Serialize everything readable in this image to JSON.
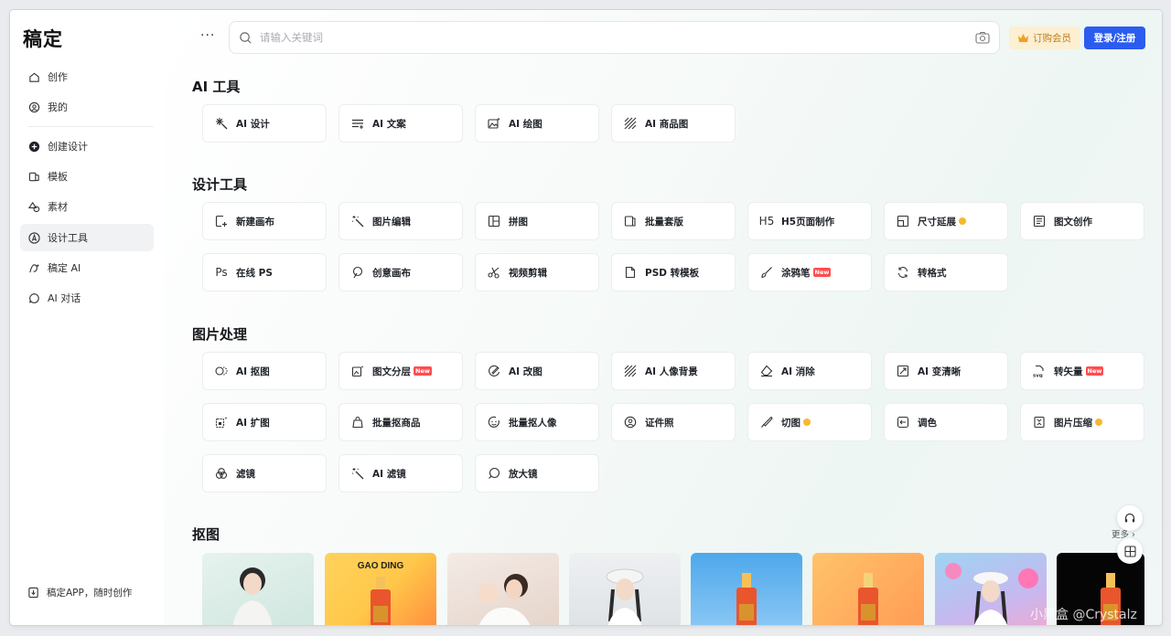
{
  "app": {
    "logo": "稿定"
  },
  "sidebar": {
    "items": [
      {
        "label": "创作",
        "icon": "home-icon"
      },
      {
        "label": "我的",
        "icon": "user-icon"
      },
      {
        "label": "创建设计",
        "icon": "plus-circle-icon"
      },
      {
        "label": "模板",
        "icon": "template-icon"
      },
      {
        "label": "素材",
        "icon": "shapes-icon"
      },
      {
        "label": "设计工具",
        "icon": "compass-icon",
        "active": true
      },
      {
        "label": "稿定 AI",
        "icon": "ai-icon"
      },
      {
        "label": "AI 对话",
        "icon": "chat-icon"
      }
    ],
    "app_link": "稿定APP，随时创作"
  },
  "header": {
    "more": "···",
    "search_placeholder": "请输入关键词",
    "vip_label": "订购会员",
    "login_label": "登录/注册"
  },
  "sections": {
    "ai_tools": {
      "title": "AI 工具",
      "items": [
        {
          "label": "AI 设计",
          "icon": "sparkle-icon"
        },
        {
          "label": "AI 文案",
          "icon": "text-lines-icon"
        },
        {
          "label": "AI 绘图",
          "icon": "image-sparkle-icon"
        },
        {
          "label": "AI 商品图",
          "icon": "diagonal-lines-icon"
        }
      ]
    },
    "design_tools": {
      "title": "设计工具",
      "items": [
        {
          "label": "新建画布",
          "icon": "new-canvas-icon"
        },
        {
          "label": "图片编辑",
          "icon": "magic-wand-icon"
        },
        {
          "label": "拼图",
          "icon": "collage-icon"
        },
        {
          "label": "批量套版",
          "icon": "batch-icon"
        },
        {
          "label": "H5页面制作",
          "icon": "h5-icon",
          "glyph": "H5"
        },
        {
          "label": "尺寸延展",
          "icon": "resize-icon",
          "vip": true
        },
        {
          "label": "图文创作",
          "icon": "document-icon"
        },
        {
          "label": "在线 PS",
          "icon": "ps-icon",
          "glyph": "Ps"
        },
        {
          "label": "创意画布",
          "icon": "creative-icon"
        },
        {
          "label": "视频剪辑",
          "icon": "scissors-icon"
        },
        {
          "label": "PSD 转模板",
          "icon": "file-icon"
        },
        {
          "label": "涂鸦笔",
          "icon": "brush-icon",
          "badge": "New"
        },
        {
          "label": "转格式",
          "icon": "convert-icon"
        }
      ]
    },
    "image_processing": {
      "title": "图片处理",
      "items": [
        {
          "label": "AI 抠图",
          "icon": "cutout-icon"
        },
        {
          "label": "图文分层",
          "icon": "layers-icon",
          "badge": "New"
        },
        {
          "label": "AI 改图",
          "icon": "edit-image-icon"
        },
        {
          "label": "AI 人像背景",
          "icon": "diagonal-lines-icon"
        },
        {
          "label": "AI 消除",
          "icon": "eraser-icon"
        },
        {
          "label": "AI 变清晰",
          "icon": "enhance-icon"
        },
        {
          "label": "转矢量",
          "icon": "svg-icon",
          "badge": "New"
        },
        {
          "label": "AI 扩图",
          "icon": "expand-icon"
        },
        {
          "label": "批量抠商品",
          "icon": "bag-icon"
        },
        {
          "label": "批量抠人像",
          "icon": "face-icon"
        },
        {
          "label": "证件照",
          "icon": "id-photo-icon"
        },
        {
          "label": "切图",
          "icon": "knife-icon",
          "vip": true
        },
        {
          "label": "调色",
          "icon": "palette-icon"
        },
        {
          "label": "图片压缩",
          "icon": "compress-icon",
          "vip": true
        },
        {
          "label": "滤镜",
          "icon": "filter-icon"
        },
        {
          "label": "AI 滤镜",
          "icon": "magic-wand-icon"
        },
        {
          "label": "放大镜",
          "icon": "magnifier-icon"
        }
      ]
    },
    "matting": {
      "title": "抠图",
      "more": "更多 ›",
      "thumb_text": "GAO DING"
    }
  },
  "colors": {
    "accent": "#2b5cf0",
    "vip_bg": "#fcefd2",
    "vip_text": "#c07c1a",
    "badge_new": "#ff4d4f",
    "vip_dot": "#f5b82e"
  },
  "watermark": "小黑盒 @Crystalz"
}
